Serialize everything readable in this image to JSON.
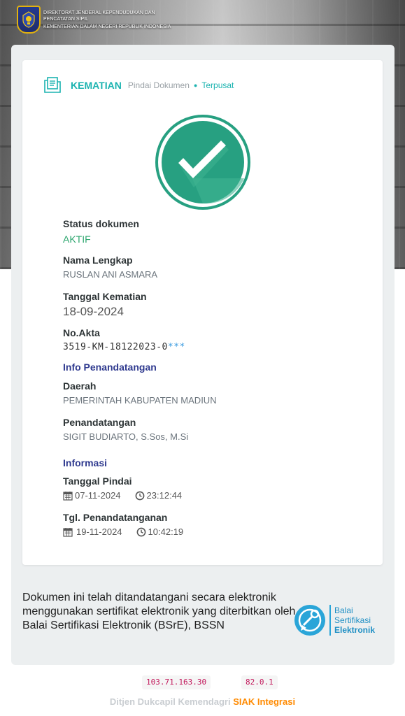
{
  "header": {
    "line1": "DIREKTORAT JENDERAL KEPENDUDUKAN DAN",
    "line2": "PENCATATAN SIPIL",
    "line3": "KEMENTERIAN DALAM NEGERI REPUBLIK INDONESIA"
  },
  "card": {
    "title": "KEMATIAN",
    "subtitle": "Pindai Dokumen",
    "dot": "●",
    "central": "Terpusat"
  },
  "fields": {
    "status_label": "Status dokumen",
    "status_value": "AKTIF",
    "name_label": "Nama Lengkap",
    "name_value": "RUSLAN ANI ASMARA",
    "death_date_label": "Tanggal Kematian",
    "death_date_value": "18-09-2024",
    "akta_label": "No.Akta",
    "akta_value": "3519-KM-18122023-0",
    "akta_mask": "***",
    "signing_info_section": "Info Penandatangan",
    "region_label": "Daerah",
    "region_value": "PEMERINTAH KABUPATEN MADIUN",
    "signer_label": "Penandatangan",
    "signer_value": "SIGIT BUDIARTO, S.Sos, M.Si",
    "info_section": "Informasi",
    "scan_label": "Tanggal Pindai",
    "scan_date": "07-11-2024",
    "scan_time": "23:12:44",
    "sign_label": "Tgl. Penandatanganan",
    "sign_date": "19-11-2024",
    "sign_time": "10:42:19"
  },
  "footer": {
    "statement": "Dokumen ini telah ditandatangani secara elektronik menggunakan sertifikat elektronik yang diterbitkan oleh Balai Sertifikasi Elektronik (BSrE), BSSN",
    "bsre_line1": "Balai",
    "bsre_line2": "Sertifikasi",
    "bsre_line3": "Elektronik",
    "ip": "103.71.163.30",
    "version": "82.0.1",
    "credit_gray": "Ditjen Dukcapil Kemendagri",
    "credit_orange": "SIAK Integrasi"
  },
  "icons": [
    "emblem-icon",
    "document-icon",
    "check-icon",
    "calendar-icon",
    "clock-icon",
    "bsre-logo-icon"
  ],
  "colors": {
    "accent": "#1bb3b0",
    "check": "#27a081",
    "status_active": "#2ea76f",
    "section": "#2f3a8f",
    "mask": "#3a9be0",
    "code": "#c2185b",
    "siak": "#ff8a00"
  }
}
